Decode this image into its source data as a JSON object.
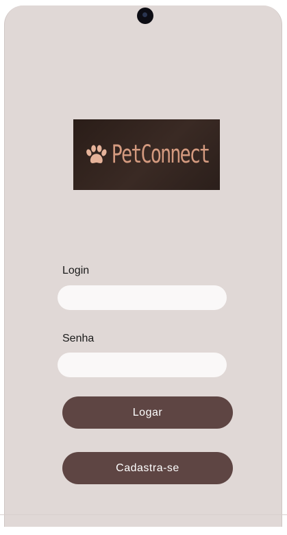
{
  "app": {
    "brand_name": "PetConnect",
    "brand_color": "#d49a7f",
    "accent_color": "#5e4543",
    "background_color": "#e0d8d6"
  },
  "login_form": {
    "login_label": "Login",
    "login_value": "",
    "password_label": "Senha",
    "password_value": ""
  },
  "actions": {
    "login_button": "Logar",
    "register_button": "Cadastra-se"
  },
  "icons": {
    "logo_icon": "paw-icon",
    "camera": "front-camera-icon"
  }
}
